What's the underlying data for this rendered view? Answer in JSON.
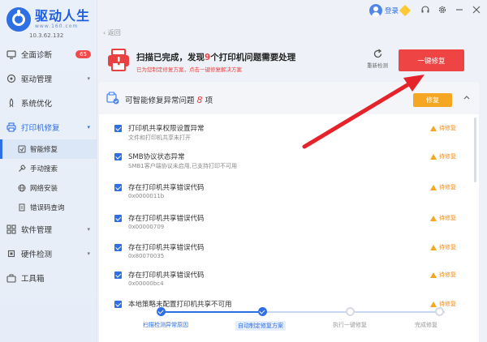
{
  "app": {
    "name": "驱动人生",
    "url": "www.160.com",
    "version": "10.3.62.132"
  },
  "sidebar": {
    "items": [
      {
        "label": "全面诊断",
        "badge": "65"
      },
      {
        "label": "驱动管理"
      },
      {
        "label": "系统优化"
      },
      {
        "label": "打印机修复"
      },
      {
        "label": "软件管理"
      },
      {
        "label": "硬件检测"
      },
      {
        "label": "工具箱"
      }
    ],
    "sub_items": [
      {
        "label": "智能修复"
      },
      {
        "label": "手动搜索"
      },
      {
        "label": "网络安装"
      },
      {
        "label": "错误码查询"
      }
    ]
  },
  "topbar": {
    "login_label": "登录"
  },
  "back_label": "返回",
  "header": {
    "title_prefix": "扫描已完成，发现",
    "issue_count": "9",
    "title_suffix": "个打印机问题需要处理",
    "subtitle": "已为您制定修复方案，点击一键修复解决方案",
    "rescan_label": "重新检测",
    "fix_all_label": "一键修复"
  },
  "panel": {
    "title": "可智能修复异常问题",
    "count": "8",
    "count_unit": "项",
    "fix_label": "修复",
    "rows": [
      {
        "title": "打印机共享权限设置异常",
        "sub": "文件和打印机共享未打开",
        "status": "待修复"
      },
      {
        "title": "SMB协议状态异常",
        "sub": "SMB1客户端协议未启用,已支持打印不可用",
        "status": "待修复"
      },
      {
        "title": "存在打印机共享错误代码",
        "sub": "0x0000011b",
        "status": "待修复"
      },
      {
        "title": "存在打印机共享错误代码",
        "sub": "0x00000709",
        "status": "待修复"
      },
      {
        "title": "存在打印机共享错误代码",
        "sub": "0x80070035",
        "status": "待修复"
      },
      {
        "title": "存在打印机共享错误代码",
        "sub": "0x00000bc4",
        "status": "待修复"
      },
      {
        "title": "本地策略未配置打印机共享不可用",
        "sub": "",
        "status": "待修复"
      }
    ]
  },
  "steps": [
    {
      "label": "扫描检测异常原因"
    },
    {
      "label": "自动制定修复方案"
    },
    {
      "label": "执行一键修复"
    },
    {
      "label": "完成修复"
    }
  ],
  "colors": {
    "accent": "#2f6fe4",
    "danger": "#ef4444",
    "warning": "#f5a623"
  }
}
